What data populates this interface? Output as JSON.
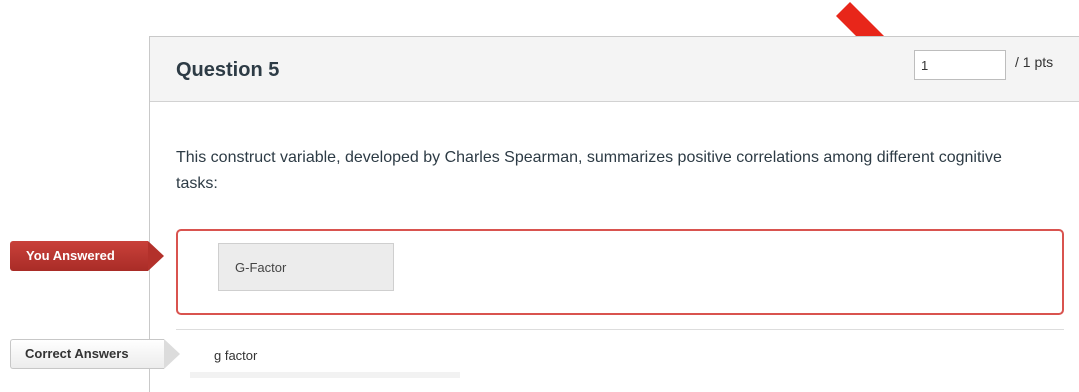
{
  "question": {
    "title": "Question 5",
    "points_value": "1",
    "points_total": "/ 1 pts",
    "text": "This construct variable, developed by Charles Spearman, summarizes positive correlations among different cognitive tasks:"
  },
  "you_answered": {
    "label": "You Answered",
    "value": "G-Factor"
  },
  "correct_answers": {
    "label": "Correct Answers",
    "value": "g factor"
  },
  "colors": {
    "incorrect_border": "#d9534f",
    "flag_red": "#b3312b",
    "arrow_red": "#e8261a"
  },
  "icons": {
    "pointer": "red-arrow-icon"
  }
}
